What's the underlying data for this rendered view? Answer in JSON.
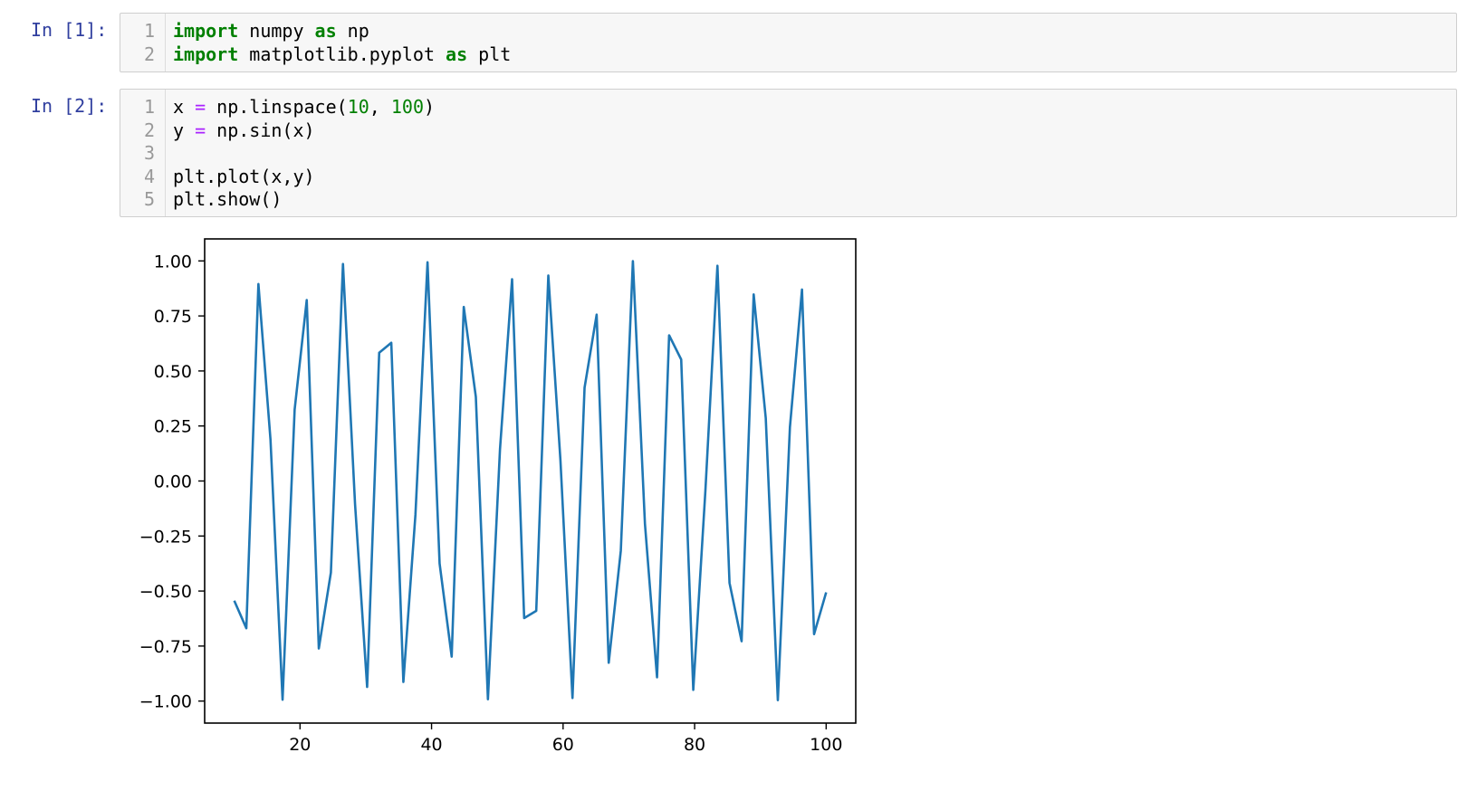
{
  "cells": [
    {
      "prompt": "In [1]:",
      "lines": [
        {
          "no": "1",
          "tokens": [
            {
              "t": "kw",
              "v": "import"
            },
            {
              "t": "plain",
              "v": " numpy "
            },
            {
              "t": "kw",
              "v": "as"
            },
            {
              "t": "plain",
              "v": " np"
            }
          ]
        },
        {
          "no": "2",
          "tokens": [
            {
              "t": "kw",
              "v": "import"
            },
            {
              "t": "plain",
              "v": " matplotlib.pyplot "
            },
            {
              "t": "kw",
              "v": "as"
            },
            {
              "t": "plain",
              "v": " plt"
            }
          ]
        }
      ]
    },
    {
      "prompt": "In [2]:",
      "lines": [
        {
          "no": "1",
          "tokens": [
            {
              "t": "plain",
              "v": "x "
            },
            {
              "t": "op",
              "v": "="
            },
            {
              "t": "plain",
              "v": " np.linspace("
            },
            {
              "t": "num",
              "v": "10"
            },
            {
              "t": "plain",
              "v": ", "
            },
            {
              "t": "num",
              "v": "100"
            },
            {
              "t": "plain",
              "v": ")"
            }
          ]
        },
        {
          "no": "2",
          "tokens": [
            {
              "t": "plain",
              "v": "y "
            },
            {
              "t": "op",
              "v": "="
            },
            {
              "t": "plain",
              "v": " np.sin(x)"
            }
          ]
        },
        {
          "no": "3",
          "tokens": []
        },
        {
          "no": "4",
          "tokens": [
            {
              "t": "plain",
              "v": "plt.plot(x,y)"
            }
          ]
        },
        {
          "no": "5",
          "tokens": [
            {
              "t": "plain",
              "v": "plt.show()"
            }
          ]
        }
      ]
    }
  ],
  "colors": {
    "prompt": "#303f9f",
    "keyword": "#008000",
    "operator": "#aa22ff",
    "number": "#008000",
    "line": "#1f77b4"
  },
  "chart_data": {
    "type": "line",
    "title": "",
    "xlabel": "",
    "ylabel": "",
    "xlim": [
      5.5,
      104.5
    ],
    "ylim": [
      -1.1,
      1.1
    ],
    "grid": false,
    "xticks": [
      20,
      40,
      60,
      80,
      100
    ],
    "xtick_labels": [
      "20",
      "40",
      "60",
      "80",
      "100"
    ],
    "yticks": [
      1.0,
      0.75,
      0.5,
      0.25,
      0.0,
      -0.25,
      -0.5,
      -0.75,
      -1.0
    ],
    "ytick_labels": [
      "1.00",
      "0.75",
      "0.50",
      "0.25",
      "0.00",
      "−0.25",
      "−0.50",
      "−0.75",
      "−1.00"
    ],
    "series": [
      {
        "x_start": 10,
        "x_end": 100,
        "points": 50,
        "y": [
          -0.544,
          -0.669,
          0.895,
          0.188,
          -0.994,
          0.325,
          0.822,
          -0.761,
          -0.416,
          0.986,
          -0.105,
          -0.936,
          0.583,
          0.628,
          -0.913,
          -0.153,
          0.994,
          -0.375,
          -0.798,
          0.791,
          0.382,
          -0.992,
          0.145,
          0.917,
          -0.623,
          -0.59,
          0.934,
          0.097,
          -0.986,
          0.424,
          0.756,
          -0.826,
          -0.317,
          0.999,
          -0.196,
          -0.892,
          0.662,
          0.552,
          -0.949,
          -0.047,
          0.978,
          -0.463,
          -0.728,
          0.848,
          0.286,
          -0.996,
          0.244,
          0.87,
          -0.696,
          -0.506
        ]
      }
    ]
  }
}
